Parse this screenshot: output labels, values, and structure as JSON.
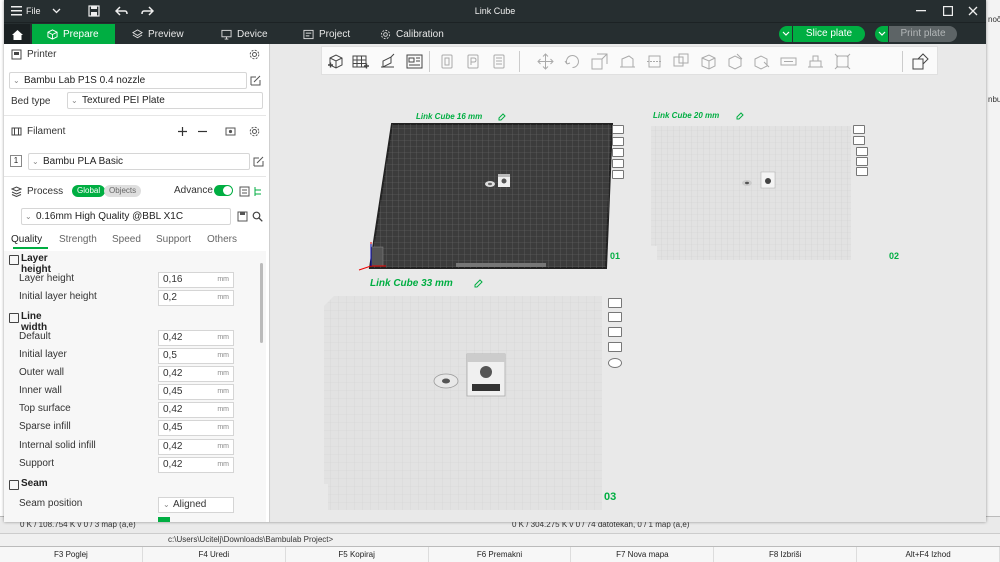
{
  "window": {
    "title": "Link Cube",
    "menu_file": "File"
  },
  "tabs": {
    "prepare": "Prepare",
    "preview": "Preview",
    "device": "Device",
    "project": "Project",
    "calibration": "Calibration"
  },
  "actions": {
    "slice_plate": "Slice plate",
    "print_plate": "Print plate"
  },
  "printer": {
    "section_title": "Printer",
    "selected": "Bambu Lab P1S 0.4 nozzle",
    "bed_type_label": "Bed type",
    "bed_type": "Textured PEI Plate"
  },
  "filament": {
    "section_title": "Filament",
    "index": "1",
    "selected": "Bambu PLA Basic",
    "color": "#00ae42"
  },
  "process": {
    "section_title": "Process",
    "scope_global": "Global",
    "scope_objects": "Objects",
    "advance_label": "Advance",
    "advance_on": true,
    "preset": "0.16mm High Quality @BBL X1C",
    "subtabs": [
      "Quality",
      "Strength",
      "Speed",
      "Support",
      "Others"
    ]
  },
  "groups": {
    "layer_height": "Layer height",
    "line_width": "Line width",
    "seam": "Seam"
  },
  "params": {
    "unit": "mm",
    "layer_height": {
      "label": "Layer height",
      "value": "0,16"
    },
    "initial_layer_height": {
      "label": "Initial layer height",
      "value": "0,2"
    },
    "lw_default": {
      "label": "Default",
      "value": "0,42"
    },
    "lw_initial_layer": {
      "label": "Initial layer",
      "value": "0,5"
    },
    "lw_outer_wall": {
      "label": "Outer wall",
      "value": "0,42"
    },
    "lw_inner_wall": {
      "label": "Inner wall",
      "value": "0,45"
    },
    "lw_top_surface": {
      "label": "Top surface",
      "value": "0,42"
    },
    "lw_sparse_infill": {
      "label": "Sparse infill",
      "value": "0,45"
    },
    "lw_internal_solid_infill": {
      "label": "Internal solid infill",
      "value": "0,42"
    },
    "lw_support": {
      "label": "Support",
      "value": "0,42"
    },
    "seam_position": {
      "label": "Seam position",
      "value": "Aligned"
    }
  },
  "plates": [
    {
      "name": "Link Cube 16 mm",
      "number": "01"
    },
    {
      "name": "Link Cube 20 mm",
      "number": "02"
    },
    {
      "name": "Link Cube 33 mm",
      "number": "03"
    }
  ],
  "background": {
    "status_left": "0 K / 108.754 K v 0 / 3 map (a,e)",
    "status_right": "0 K / 304.275 K v 0 / 74 datotekah, 0 / 1 map (a,e)",
    "cmd_path": "c:\\Users\\Ucitelj\\Downloads\\Bambulab Project>",
    "right_text_1": "noč",
    "right_text_2": "nbut",
    "fkeys": [
      "F3 Poglej",
      "F4 Uredi",
      "F5 Kopiraj",
      "F6 Premakni",
      "F7 Nova mapa",
      "F8 Izbriši",
      "Alt+F4 Izhod"
    ]
  },
  "colors": {
    "accent": "#00ae42",
    "titlebar": "#262e30",
    "plate_grid": "#3c3c3c"
  }
}
